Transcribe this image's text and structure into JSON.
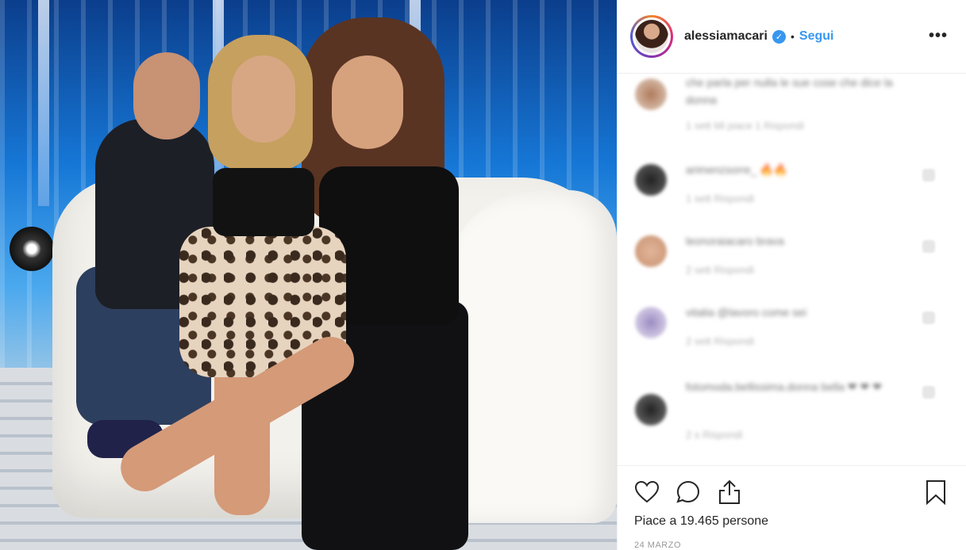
{
  "header": {
    "username": "alessiamacari",
    "separator": "•",
    "follow_label": "Segui",
    "more_label": "•••"
  },
  "comments": [
    {
      "text": "che parla per nulla le sue cose che dice la donna",
      "meta": "1 sett  Mi piace 1  Rispondi"
    },
    {
      "text": "arimenzsorre_ 🔥🔥",
      "meta": "1 sett  Rispondi"
    },
    {
      "text": "leonoraiacaro brava",
      "meta": "2 sett  Rispondi"
    },
    {
      "text": "vitalia @lavoro come sei",
      "meta": "2 sett  Rispondi"
    },
    {
      "text": "fotomoda.bellissima.donna bella ❤ ❤ ❤",
      "meta": "2 s  Rispondi"
    }
  ],
  "footer": {
    "likes_text": "Piace a 19.465 persone",
    "date": "24 MARZO"
  },
  "icons": {
    "like": "heart-icon",
    "comment": "comment-icon",
    "share": "share-icon",
    "save": "bookmark-icon",
    "verified": "verified-badge-icon"
  },
  "colors": {
    "link_blue": "#3897f0",
    "text": "#262626"
  }
}
